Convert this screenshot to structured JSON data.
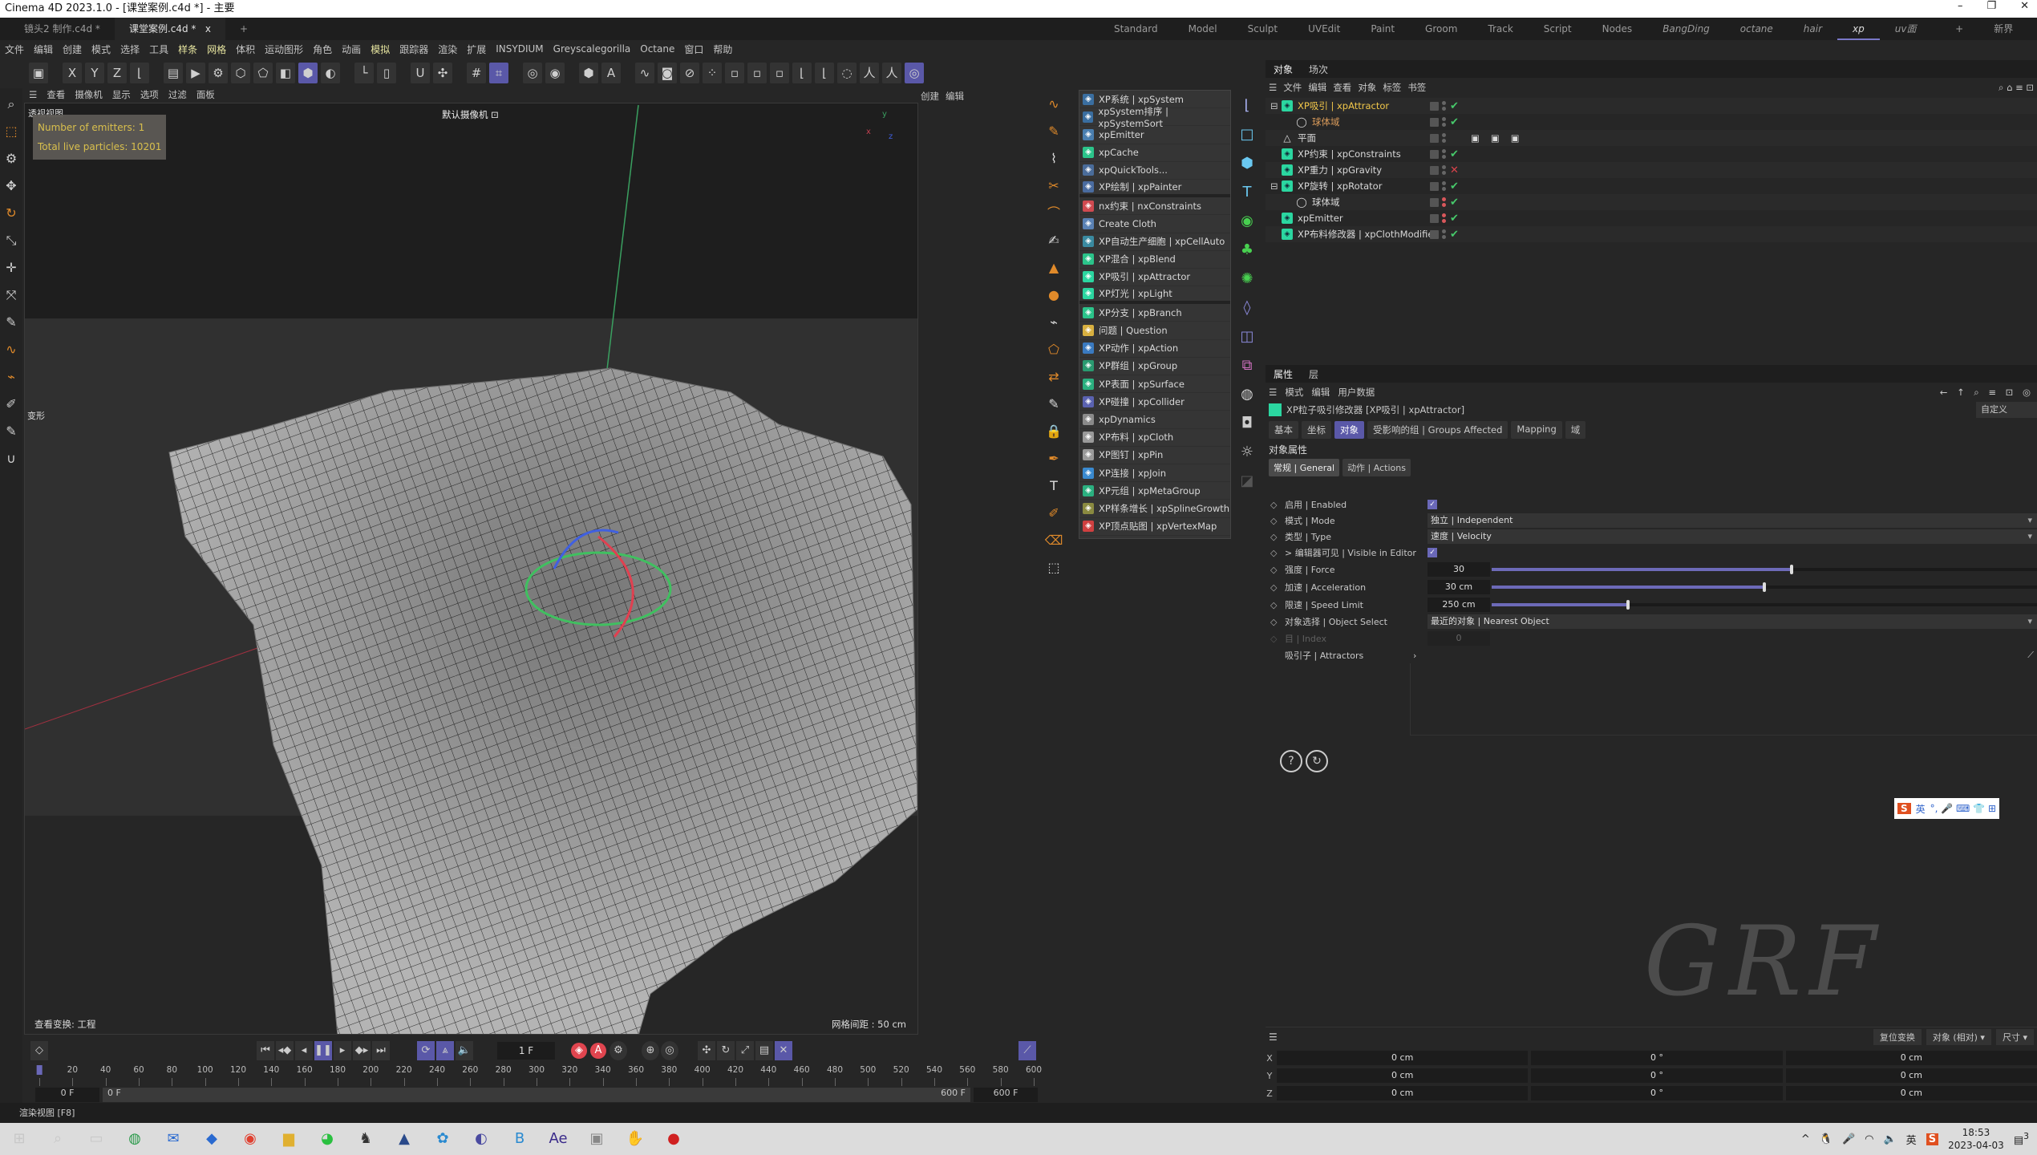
{
  "window": {
    "title": "Cinema 4D 2023.1.0 - [课堂案例.c4d *] - 主要",
    "controls": [
      "–",
      "❐",
      "✕"
    ]
  },
  "doc_tabs": [
    {
      "label": "镜头2 制作.c4d *",
      "active": false
    },
    {
      "label": "课堂案例.c4d *",
      "active": true
    }
  ],
  "tab_close": "x",
  "tab_add": "+",
  "layouts": [
    {
      "label": "Standard"
    },
    {
      "label": "Model"
    },
    {
      "label": "Sculpt"
    },
    {
      "label": "UVEdit"
    },
    {
      "label": "Paint"
    },
    {
      "label": "Groom"
    },
    {
      "label": "Track"
    },
    {
      "label": "Script"
    },
    {
      "label": "Nodes"
    },
    {
      "label": "BangDing",
      "italic": true
    },
    {
      "label": "octane",
      "italic": true
    },
    {
      "label": "hair",
      "italic": true
    },
    {
      "label": "xp",
      "italic": true,
      "active": true
    },
    {
      "label": "uv面板",
      "italic": true
    },
    {
      "label": "+"
    },
    {
      "label": "新界面"
    }
  ],
  "menubar": [
    {
      "label": "文件"
    },
    {
      "label": "编辑"
    },
    {
      "label": "创建"
    },
    {
      "label": "模式"
    },
    {
      "label": "选择"
    },
    {
      "label": "工具"
    },
    {
      "label": "样条",
      "hl": true
    },
    {
      "label": "网格",
      "hl": true
    },
    {
      "label": "体积"
    },
    {
      "label": "运动图形"
    },
    {
      "label": "角色"
    },
    {
      "label": "动画"
    },
    {
      "label": "模拟",
      "hl": true
    },
    {
      "label": "跟踪器"
    },
    {
      "label": "渲染"
    },
    {
      "label": "扩展"
    },
    {
      "label": "INSYDIUM"
    },
    {
      "label": "Greyscalegorilla"
    },
    {
      "label": "Octane"
    },
    {
      "label": "窗口"
    },
    {
      "label": "帮助"
    }
  ],
  "toolbar": [
    {
      "icon": "undo-icon",
      "g": "▣"
    },
    {
      "icon": "x-axis-lock-icon",
      "g": "X",
      "gap": true
    },
    {
      "icon": "y-axis-lock-icon",
      "g": "Y"
    },
    {
      "icon": "z-axis-lock-icon",
      "g": "Z"
    },
    {
      "icon": "coordinate-system-icon",
      "g": "⌊"
    },
    {
      "icon": "render-region-icon",
      "g": "▤",
      "gap": true
    },
    {
      "icon": "render-view-icon",
      "g": "▶"
    },
    {
      "icon": "render-settings-icon",
      "g": "⚙"
    },
    {
      "icon": "points-mode-icon",
      "g": "⬡"
    },
    {
      "icon": "edges-mode-icon",
      "g": "⬠"
    },
    {
      "icon": "polygons-mode-icon",
      "g": "◧"
    },
    {
      "icon": "model-mode-icon",
      "g": "⬢",
      "on": true
    },
    {
      "icon": "texture-mode-icon",
      "g": "◐"
    },
    {
      "icon": "axis-icon",
      "g": "└",
      "gap": true
    },
    {
      "icon": "workplane-icon",
      "g": "▯"
    },
    {
      "icon": "snap-icon",
      "g": "U",
      "gap": true
    },
    {
      "icon": "snap-settings-icon",
      "g": "✣"
    },
    {
      "icon": "grid-icon",
      "g": "#",
      "gap": true
    },
    {
      "icon": "quantize-icon",
      "g": "⌗",
      "on": true
    },
    {
      "icon": "lock-icon",
      "g": "◎",
      "gap": true
    },
    {
      "icon": "viewport-solo-icon",
      "g": "◉"
    },
    {
      "icon": "octane-icon",
      "g": "⬢",
      "gap": true
    },
    {
      "icon": "octane-a-icon",
      "g": "A"
    },
    {
      "icon": "spline-pen-icon",
      "g": "∿",
      "gap": true
    },
    {
      "icon": "camera-icon",
      "g": "◙"
    },
    {
      "icon": "null-icon",
      "g": "⊘"
    },
    {
      "icon": "particles-icon",
      "g": "⁘"
    },
    {
      "icon": "dim-icon-1",
      "g": "▫"
    },
    {
      "icon": "dim-icon-2",
      "g": "▫"
    },
    {
      "icon": "dim-icon-3",
      "g": "▫"
    },
    {
      "icon": "joint-icon",
      "g": "⌊"
    },
    {
      "icon": "ik-icon",
      "g": "⌊"
    },
    {
      "icon": "pose-icon",
      "g": "◌"
    },
    {
      "icon": "character-icon",
      "g": "人"
    },
    {
      "icon": "character-orange-icon",
      "g": "人"
    },
    {
      "icon": "xp-system-icon",
      "g": "◎",
      "on": true
    }
  ],
  "left_tools": [
    {
      "icon": "search-icon",
      "g": "⌕"
    },
    {
      "icon": "live-selection-icon",
      "g": "⬚",
      "or": true
    },
    {
      "icon": "selection-tool-icon",
      "g": "⚙"
    },
    {
      "icon": "move-icon",
      "g": "✥"
    },
    {
      "icon": "rotate-icon",
      "g": "↻",
      "or": true
    },
    {
      "icon": "scale-icon",
      "g": "⤡"
    },
    {
      "icon": "transform-icon",
      "g": "✛"
    },
    {
      "icon": "extrude-icon",
      "g": "⤧"
    },
    {
      "icon": "knife-icon",
      "g": "✎"
    },
    {
      "icon": "spline-icon",
      "g": "∿",
      "or": true
    },
    {
      "icon": "brush-icon",
      "g": "⌁",
      "or": true
    },
    {
      "icon": "sculpt-icon",
      "g": "✐"
    },
    {
      "icon": "paint-icon",
      "g": "✎"
    },
    {
      "icon": "magnet-icon",
      "g": "∪"
    }
  ],
  "viewport": {
    "menu": [
      "查看",
      "摄像机",
      "显示",
      "选项",
      "过滤",
      "面板"
    ],
    "name": "透视视图",
    "hud": [
      "Number of emitters: 1",
      "Total live particles: 10201"
    ],
    "camera": "默认摄像机 ⊡",
    "view_transform": "查看变换: 工程",
    "grid_spacing": "网格间距 : 50 cm",
    "deform_label": "变形"
  },
  "side_menu": [
    "创建",
    "编辑"
  ],
  "xp_menu": [
    {
      "label": "XP系统 | xpSystem",
      "c": "#3a6ea0"
    },
    {
      "label": "xpSystem排序 | xpSystemSort",
      "c": "#3a6ea0"
    },
    {
      "label": "xpEmitter",
      "c": "#4a7fb0"
    },
    {
      "label": "xpCache",
      "c": "#2bc48a"
    },
    {
      "label": "xpQuickTools...",
      "c": "#4a6c9a"
    },
    {
      "label": "XP绘制 | xpPainter",
      "c": "#4a6ca0",
      "sep": true
    },
    {
      "label": "nx约束 | nxConstraints",
      "c": "#d04a50"
    },
    {
      "label": "Create Cloth",
      "c": "#5a82b5"
    },
    {
      "label": "XP自动生产细胞 | xpCellAuto",
      "c": "#3a8aa0"
    },
    {
      "label": "XP混合 | xpBlend",
      "c": "#2bc48a"
    },
    {
      "label": "XP吸引 | xpAttractor",
      "c": "#2bd6a0"
    },
    {
      "label": "XP灯光 | xpLight",
      "c": "#2bd6a0",
      "sep": true
    },
    {
      "label": "XP分支 | xpBranch",
      "c": "#2bc48a"
    },
    {
      "label": "问题 | Question",
      "c": "#d8b040"
    },
    {
      "label": "XP动作 | xpAction",
      "c": "#3a7ac0"
    },
    {
      "label": "XP群组 | xpGroup",
      "c": "#2a9a70"
    },
    {
      "label": "XP表面 | xpSurface",
      "c": "#2bb080"
    },
    {
      "label": "XP碰撞 | xpCollider",
      "c": "#5a62b0"
    },
    {
      "label": "xpDynamics",
      "c": "#8a8a8a"
    },
    {
      "label": "XP布料 | xpCloth",
      "c": "#9a9a9a"
    },
    {
      "label": "XP图钉 | xpPin",
      "c": "#9a9a9a"
    },
    {
      "label": "XP连接 | xpJoin",
      "c": "#3a8ad0"
    },
    {
      "label": "XP元组 | xpMetaGroup",
      "c": "#2bb080"
    },
    {
      "label": "XP样条增长 | xpSplineGrowth",
      "c": "#8a8a40"
    },
    {
      "label": "XP顶点贴图 | xpVertexMap",
      "c": "#d04040"
    }
  ],
  "icon_column": [
    {
      "icon": "coordinate-object-icon",
      "g": "⌊",
      "c": "#a8b0f0"
    },
    {
      "icon": "cube-outline-icon",
      "g": "□",
      "c": "#6ac8f0"
    },
    {
      "icon": "cube-icon",
      "g": "⬢",
      "c": "#6ac8f0"
    },
    {
      "icon": "text-icon",
      "g": "T",
      "c": "#6ac8f0"
    },
    {
      "icon": "particle-green-icon",
      "g": "◉",
      "c": "#48d050"
    },
    {
      "icon": "cubes-green-icon",
      "g": "♣",
      "c": "#48d050"
    },
    {
      "icon": "gear-green-icon",
      "g": "✺",
      "c": "#48d050"
    },
    {
      "icon": "deformer-icon",
      "g": "◊",
      "c": "#8a88d8"
    },
    {
      "icon": "field-icon",
      "g": "◫",
      "c": "#8a88d8"
    },
    {
      "icon": "tag-icon",
      "g": "⧉",
      "c": "#d070c0"
    },
    {
      "icon": "sky-icon",
      "g": "◍",
      "c": "#ccc"
    },
    {
      "icon": "camera-st-icon",
      "g": "◘",
      "c": "#ccc"
    },
    {
      "icon": "light-st-icon",
      "g": "☼",
      "c": "#ccc"
    },
    {
      "icon": "disabled-icon",
      "g": "◪",
      "c": "#555"
    }
  ],
  "object_manager": {
    "tabs": [
      "对象",
      "场次"
    ],
    "menu": [
      "文件",
      "编辑",
      "查看",
      "对象",
      "标签",
      "书签"
    ],
    "rows": [
      {
        "name": "XP吸引 | xpAttractor",
        "state": "selected",
        "depth": 0,
        "expand": "⊟",
        "check": "✔",
        "dots": "grey"
      },
      {
        "name": "球体域",
        "state": "sub",
        "depth": 1,
        "check": "✔",
        "dots": "grey",
        "icon": "sphere-field-icon"
      },
      {
        "name": "平面",
        "depth": 0,
        "check": "",
        "dots": "grey",
        "icon": "plane-icon",
        "tags": [
          "phong-tag-icon",
          "material-tag-icon",
          "cloth-tag-icon"
        ]
      },
      {
        "name": "XP约束 | xpConstraints",
        "depth": 0,
        "check": "✔",
        "dots": "grey"
      },
      {
        "name": "XP重力 | xpGravity",
        "depth": 0,
        "check": "✕",
        "dots": "grey"
      },
      {
        "name": "XP旋转 | xpRotator",
        "depth": 0,
        "expand": "⊟",
        "check": "✔",
        "dots": "grey"
      },
      {
        "name": "球体域",
        "depth": 1,
        "check": "✔",
        "dots": "red",
        "icon": "sphere-field-icon"
      },
      {
        "name": "xpEmitter",
        "depth": 0,
        "check": "✔",
        "dots": "red"
      },
      {
        "name": "XP布料修改器 | xpClothModifier",
        "depth": 0,
        "check": "✔",
        "dots": "grey"
      }
    ]
  },
  "attributes": {
    "tabs": [
      "属性",
      "层"
    ],
    "menu": [
      "模式",
      "编辑",
      "用户数据"
    ],
    "object_title": "XP粒子吸引修改器 [XP吸引 | xpAttractor]",
    "preset": "自定义",
    "pages": [
      {
        "label": "基本"
      },
      {
        "label": "坐标"
      },
      {
        "label": "对象",
        "active": true
      },
      {
        "label": "受影响的组 | Groups Affected"
      },
      {
        "label": "Mapping"
      },
      {
        "label": "域"
      }
    ],
    "group_title": "对象属性",
    "subpages": [
      {
        "label": "常规 | General",
        "active": true
      },
      {
        "label": "动作 | Actions"
      }
    ],
    "enabled": {
      "label": "启用 | Enabled",
      "checked": true
    },
    "mode": {
      "label": "模式 | Mode",
      "value": "独立 | Independent"
    },
    "type": {
      "label": "类型 | Type",
      "value": "速度 | Velocity"
    },
    "visible": {
      "label": "> 编辑器可见 | Visible in Editor",
      "checked": true
    },
    "force": {
      "label": "强度 | Force",
      "value": "30",
      "slider_fraction": 0.55
    },
    "acceleration": {
      "label": "加速 | Acceleration",
      "value": "30 cm",
      "slider_fraction": 0.5
    },
    "speed_limit": {
      "label": "限速 | Speed Limit",
      "value": "250 cm",
      "slider_fraction": 0.25
    },
    "object_select": {
      "label": "对象选择 | Object Select",
      "value": "最近的对象 | Nearest Object"
    },
    "index": {
      "label": "目 | Index",
      "value": "0"
    },
    "attractors": {
      "label": "吸引子 | Attractors",
      "arrow": "›"
    }
  },
  "ime": {
    "brand": "S",
    "lang": "英"
  },
  "watermark": "GRF",
  "coordinates": {
    "buttons": [
      "复位变换",
      "对象 (相对) ▾",
      "尺寸 ▾"
    ],
    "rows": [
      {
        "axis": "X",
        "pos": "0 cm",
        "rot": "0 °",
        "size": "0 cm"
      },
      {
        "axis": "Y",
        "pos": "0 cm",
        "rot": "0 °",
        "size": "0 cm"
      },
      {
        "axis": "Z",
        "pos": "0 cm",
        "rot": "0 °",
        "size": "0 cm"
      }
    ]
  },
  "timeline": {
    "current_frame": "1 F",
    "ticks": [
      0,
      20,
      40,
      60,
      80,
      100,
      120,
      140,
      160,
      180,
      200,
      220,
      240,
      260,
      280,
      300,
      320,
      340,
      360,
      380,
      400,
      420,
      440,
      460,
      480,
      500,
      520,
      540,
      560,
      580,
      600
    ],
    "start": "0 F",
    "range_start": "0 F",
    "range_end": "600 F",
    "end": "600 F"
  },
  "status": "渲染视图 [F8]",
  "taskbar": {
    "apps": [
      {
        "icon": "start-icon",
        "g": "⊞"
      },
      {
        "icon": "search-icon",
        "g": "⌕"
      },
      {
        "icon": "task-view-icon",
        "g": "▭"
      },
      {
        "icon": "browser-360-icon",
        "g": "◍",
        "c": "#2a9a4a"
      },
      {
        "icon": "mail-icon",
        "g": "✉",
        "c": "#2a6ad0"
      },
      {
        "icon": "baidu-icon",
        "g": "◆",
        "c": "#2a6ad0"
      },
      {
        "icon": "chrome-icon",
        "g": "◉",
        "c": "#e04030"
      },
      {
        "icon": "explorer-icon",
        "g": "▆",
        "c": "#e0b030"
      },
      {
        "icon": "wechat-icon",
        "g": "◕",
        "c": "#2ac040"
      },
      {
        "icon": "cinema4d-blender-icon",
        "g": "♞",
        "c": "#333"
      },
      {
        "icon": "app-icon",
        "g": "▲",
        "c": "#2a4a8a"
      },
      {
        "icon": "bilibili-icon",
        "g": "✿",
        "c": "#2a8ad0"
      },
      {
        "icon": "cinema4d-icon",
        "g": "◐",
        "c": "#4a4aa0"
      },
      {
        "icon": "app-b-icon",
        "g": "B",
        "c": "#2a8ad0"
      },
      {
        "icon": "after-effects-icon",
        "g": "Ae",
        "c": "#3a2a8a"
      },
      {
        "icon": "app-gray-icon",
        "g": "▣",
        "c": "#888"
      },
      {
        "icon": "app-yellow-icon",
        "g": "✋",
        "c": "#c8a020"
      },
      {
        "icon": "record-icon",
        "g": "●",
        "c": "#d02020"
      }
    ],
    "tray": {
      "chevron": "^",
      "lang": "英",
      "time": "18:53",
      "date": "2023-04-03",
      "notifications": "3"
    }
  }
}
